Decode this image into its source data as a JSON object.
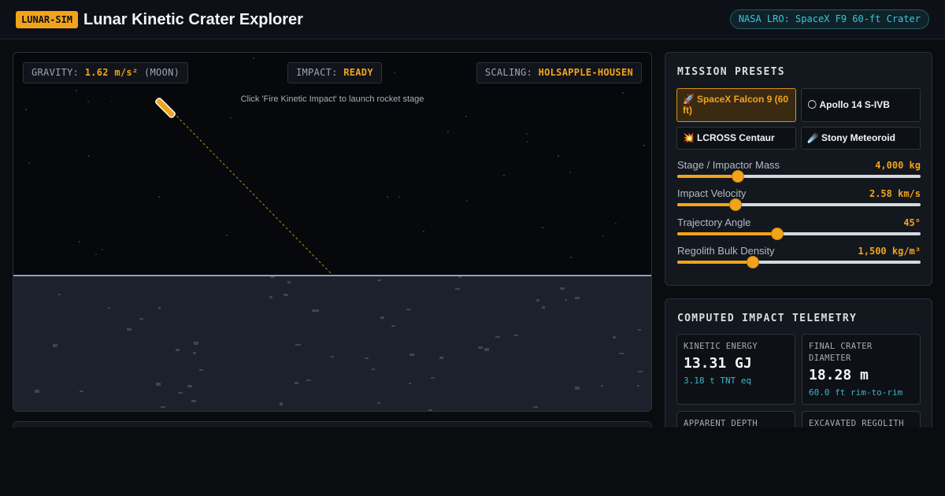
{
  "header": {
    "badge": "LUNAR-SIM",
    "title": "Lunar Kinetic Crater Explorer",
    "source": "NASA LRO: SpaceX F9 60-ft Crater"
  },
  "simulation": {
    "gravity_label": "GRAVITY:",
    "gravity_value": "1.62 m/s²",
    "gravity_suffix": "(MOON)",
    "impact_label": "IMPACT:",
    "impact_value": "READY",
    "scaling_label": "SCALING:",
    "scaling_value": "HOLSAPPLE-HOUSEN",
    "hint": "Click 'Fire Kinetic Impact' to launch rocket stage"
  },
  "presets": {
    "heading": "MISSION PRESETS",
    "items": [
      {
        "icon": "🚀",
        "label": "SpaceX Falcon 9 (60 ft)",
        "active": true
      },
      {
        "icon": "🌕",
        "label": "Apollo 14 S-IVB",
        "active": false
      },
      {
        "icon": "💥",
        "label": "LCROSS Centaur",
        "active": false
      },
      {
        "icon": "☄️",
        "label": "Stony Meteoroid",
        "active": false
      }
    ]
  },
  "sliders": [
    {
      "label": "Stage / Impactor Mass",
      "value": "4,000 kg",
      "fraction": 0.25
    },
    {
      "label": "Impact Velocity",
      "value": "2.58 km/s",
      "fraction": 0.24
    },
    {
      "label": "Trajectory Angle",
      "value": "45°",
      "fraction": 0.41
    },
    {
      "label": "Regolith Bulk Density",
      "value": "1,500 kg/m³",
      "fraction": 0.31
    }
  ],
  "telemetry": {
    "heading": "COMPUTED IMPACT TELEMETRY",
    "cards": [
      {
        "label": "KINETIC ENERGY",
        "value": "13.31 GJ",
        "sub": "3.18 t TNT eq"
      },
      {
        "label": "FINAL CRATER DIAMETER",
        "value": "18.28 m",
        "sub": "60.0 ft rim-to-rim"
      },
      {
        "label": "APPARENT DEPTH",
        "value": "",
        "sub": ""
      },
      {
        "label": "EXCAVATED REGOLITH",
        "value": "",
        "sub": ""
      }
    ]
  },
  "colors": {
    "accent": "#f2a31c",
    "cyan": "#3fc3d8",
    "ground": "#1c212b",
    "background": "#0a0c10"
  }
}
